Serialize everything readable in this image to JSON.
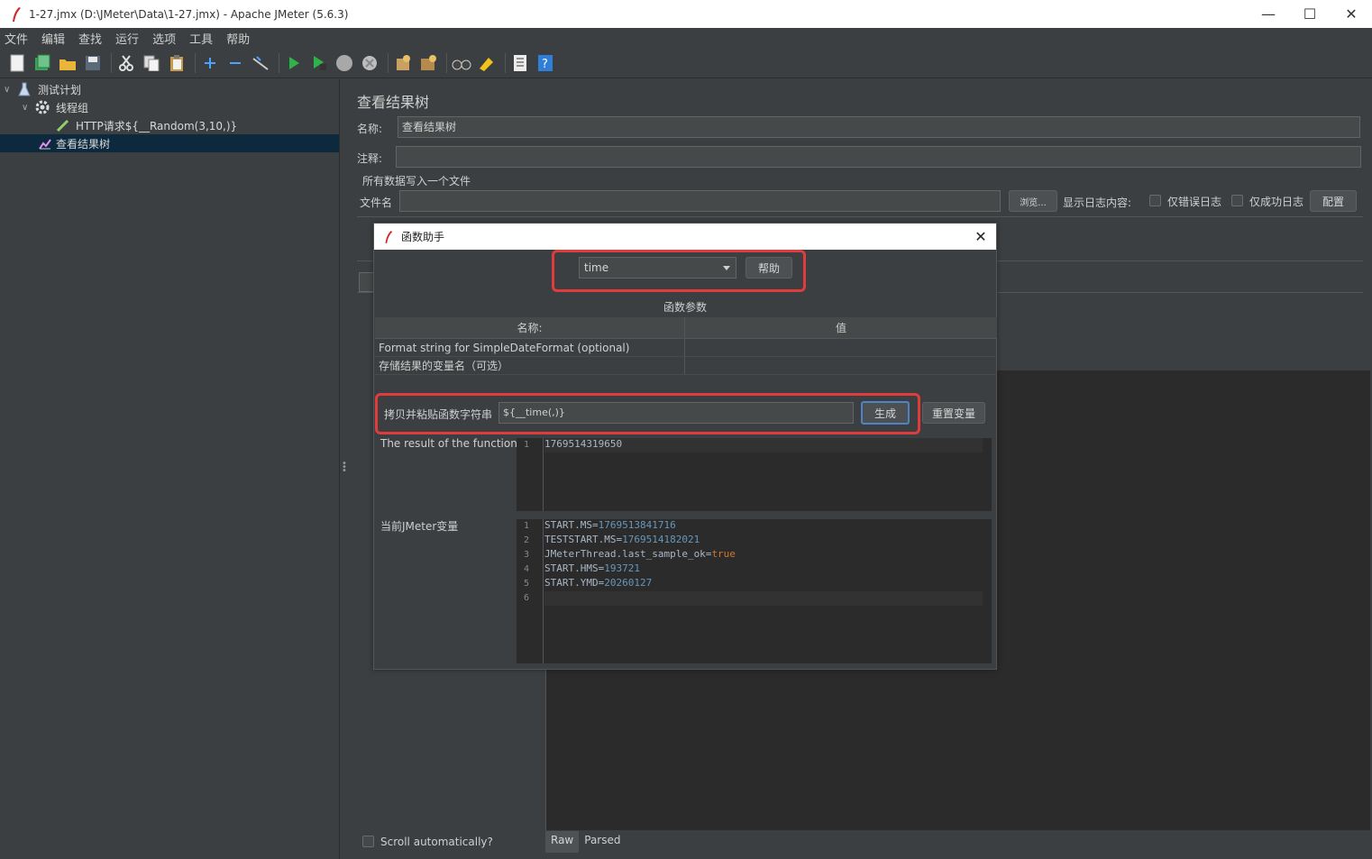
{
  "window": {
    "title": "1-27.jmx (D:\\JMeter\\Data\\1-27.jmx) - Apache JMeter (5.6.3)"
  },
  "menu": [
    "文件",
    "编辑",
    "查找",
    "运行",
    "选项",
    "工具",
    "帮助"
  ],
  "tree": {
    "items": [
      {
        "label": "测试计划",
        "icon": "flask-icon"
      },
      {
        "label": "线程组",
        "icon": "gear-icon"
      },
      {
        "label": "HTTP请求${__Random(3,10,)}",
        "icon": "pipette-icon"
      },
      {
        "label": "查看结果树",
        "icon": "chart-icon"
      }
    ]
  },
  "panel": {
    "title": "查看结果树",
    "name_label": "名称:",
    "name_value": "查看结果树",
    "comment_label": "注释:",
    "comment_value": "",
    "write_all_label": "所有数据写入一个文件",
    "filename_label": "文件名",
    "filename_value": "",
    "browse_button": "浏览...",
    "log_display_label": "显示日志内容:",
    "errors_only_label": "仅错误日志",
    "success_only_label": "仅成功日志",
    "config_button": "配置",
    "scroll_auto_label": "Scroll automatically?",
    "tab_raw": "Raw",
    "tab_parsed": "Parsed"
  },
  "dialog": {
    "title": "函数助手",
    "function_selected": "time",
    "help_button": "帮助",
    "params_title": "函数参数",
    "table_headers": [
      "名称:",
      "值"
    ],
    "table_rows": [
      {
        "name": "Format string for SimpleDateFormat (optional)",
        "value": ""
      },
      {
        "name": "存储结果的变量名（可选）",
        "value": ""
      }
    ],
    "copy_label": "拷贝并粘贴函数字符串",
    "function_string": "${__time(,)}",
    "generate_button": "生成",
    "reset_button": "重置变量",
    "result_label": "The result of the function is",
    "result_lines": [
      "1769514319650"
    ],
    "vars_label": "当前JMeter变量",
    "vars_lines": [
      {
        "key": "START.MS=",
        "value": "1769513841716"
      },
      {
        "key": "TESTSTART.MS=",
        "value": "1769514182021"
      },
      {
        "key": "JMeterThread.last_sample_ok=",
        "value": "true"
      },
      {
        "key": "START.HMS=",
        "value": "193721"
      },
      {
        "key": "START.YMD=",
        "value": "20260127"
      },
      {
        "key": "",
        "value": ""
      }
    ],
    "highlight_color": "#e03c3c"
  }
}
